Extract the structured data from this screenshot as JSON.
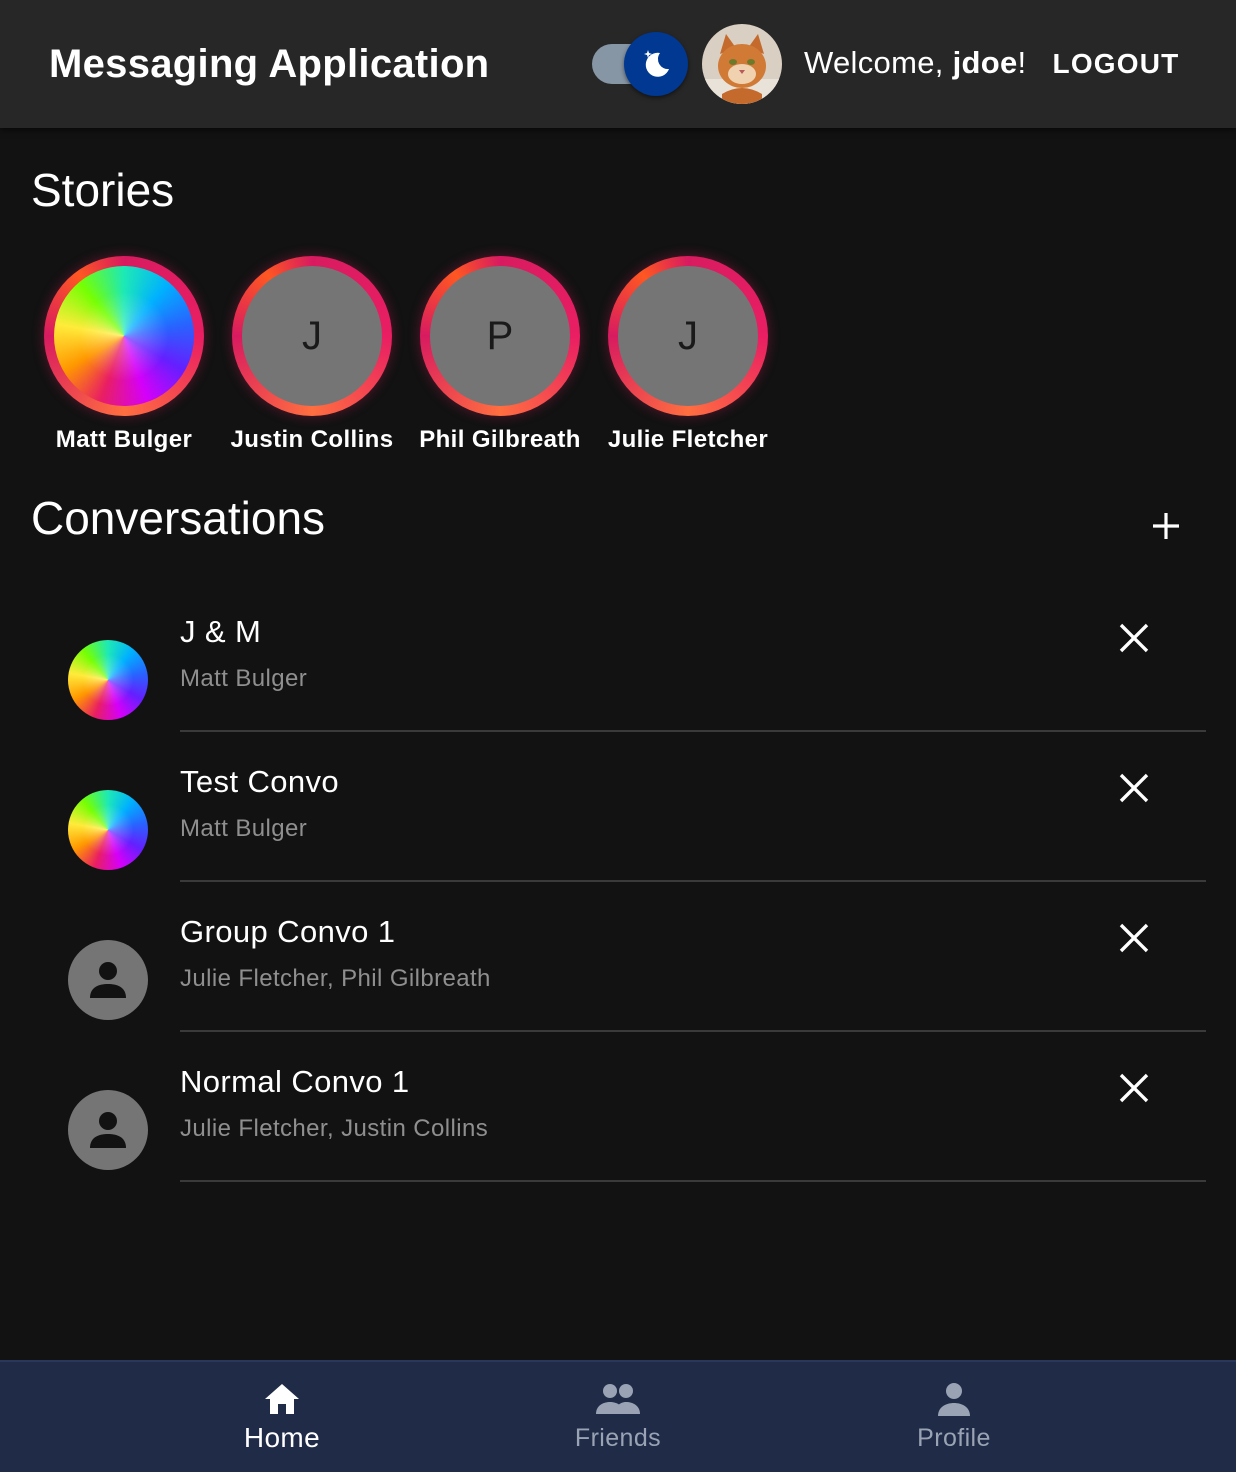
{
  "header": {
    "title": "Messaging Application",
    "theme_toggle": {
      "mode": "dark",
      "icon": "moon-icon"
    },
    "avatar_icon": "cat-photo",
    "welcome_prefix": "Welcome, ",
    "username": "jdoe",
    "welcome_suffix": "!",
    "logout_label": "LOGOUT"
  },
  "stories": {
    "title": "Stories",
    "items": [
      {
        "name": "Matt Bulger",
        "initial": "",
        "avatar": "rainbow-gradient"
      },
      {
        "name": "Justin Collins",
        "initial": "J",
        "avatar": "initial"
      },
      {
        "name": "Phil Gilbreath",
        "initial": "P",
        "avatar": "initial"
      },
      {
        "name": "Julie Fletcher",
        "initial": "J",
        "avatar": "initial"
      }
    ]
  },
  "conversations": {
    "title": "Conversations",
    "add_icon": "plus-icon",
    "items": [
      {
        "title": "J & M",
        "members": "Matt Bulger",
        "avatar": "rainbow-gradient"
      },
      {
        "title": "Test Convo",
        "members": "Matt Bulger",
        "avatar": "rainbow-gradient"
      },
      {
        "title": "Group Convo 1",
        "members": "Julie Fletcher, Phil Gilbreath",
        "avatar": "person-icon"
      },
      {
        "title": "Normal Convo 1",
        "members": "Julie Fletcher, Justin Collins",
        "avatar": "person-icon"
      }
    ]
  },
  "bottom_nav": {
    "items": [
      {
        "label": "Home",
        "icon": "home-icon",
        "active": true
      },
      {
        "label": "Friends",
        "icon": "people-icon",
        "active": false
      },
      {
        "label": "Profile",
        "icon": "person-icon",
        "active": false
      }
    ]
  },
  "colors": {
    "background": "#121212",
    "appbar": "#272727",
    "toggle_thumb": "#003892",
    "toggle_track": "#8796a5",
    "story_ring": "#e91e63",
    "bottom_nav": "#1f2b47",
    "secondary_text": "#8f8f8f"
  }
}
